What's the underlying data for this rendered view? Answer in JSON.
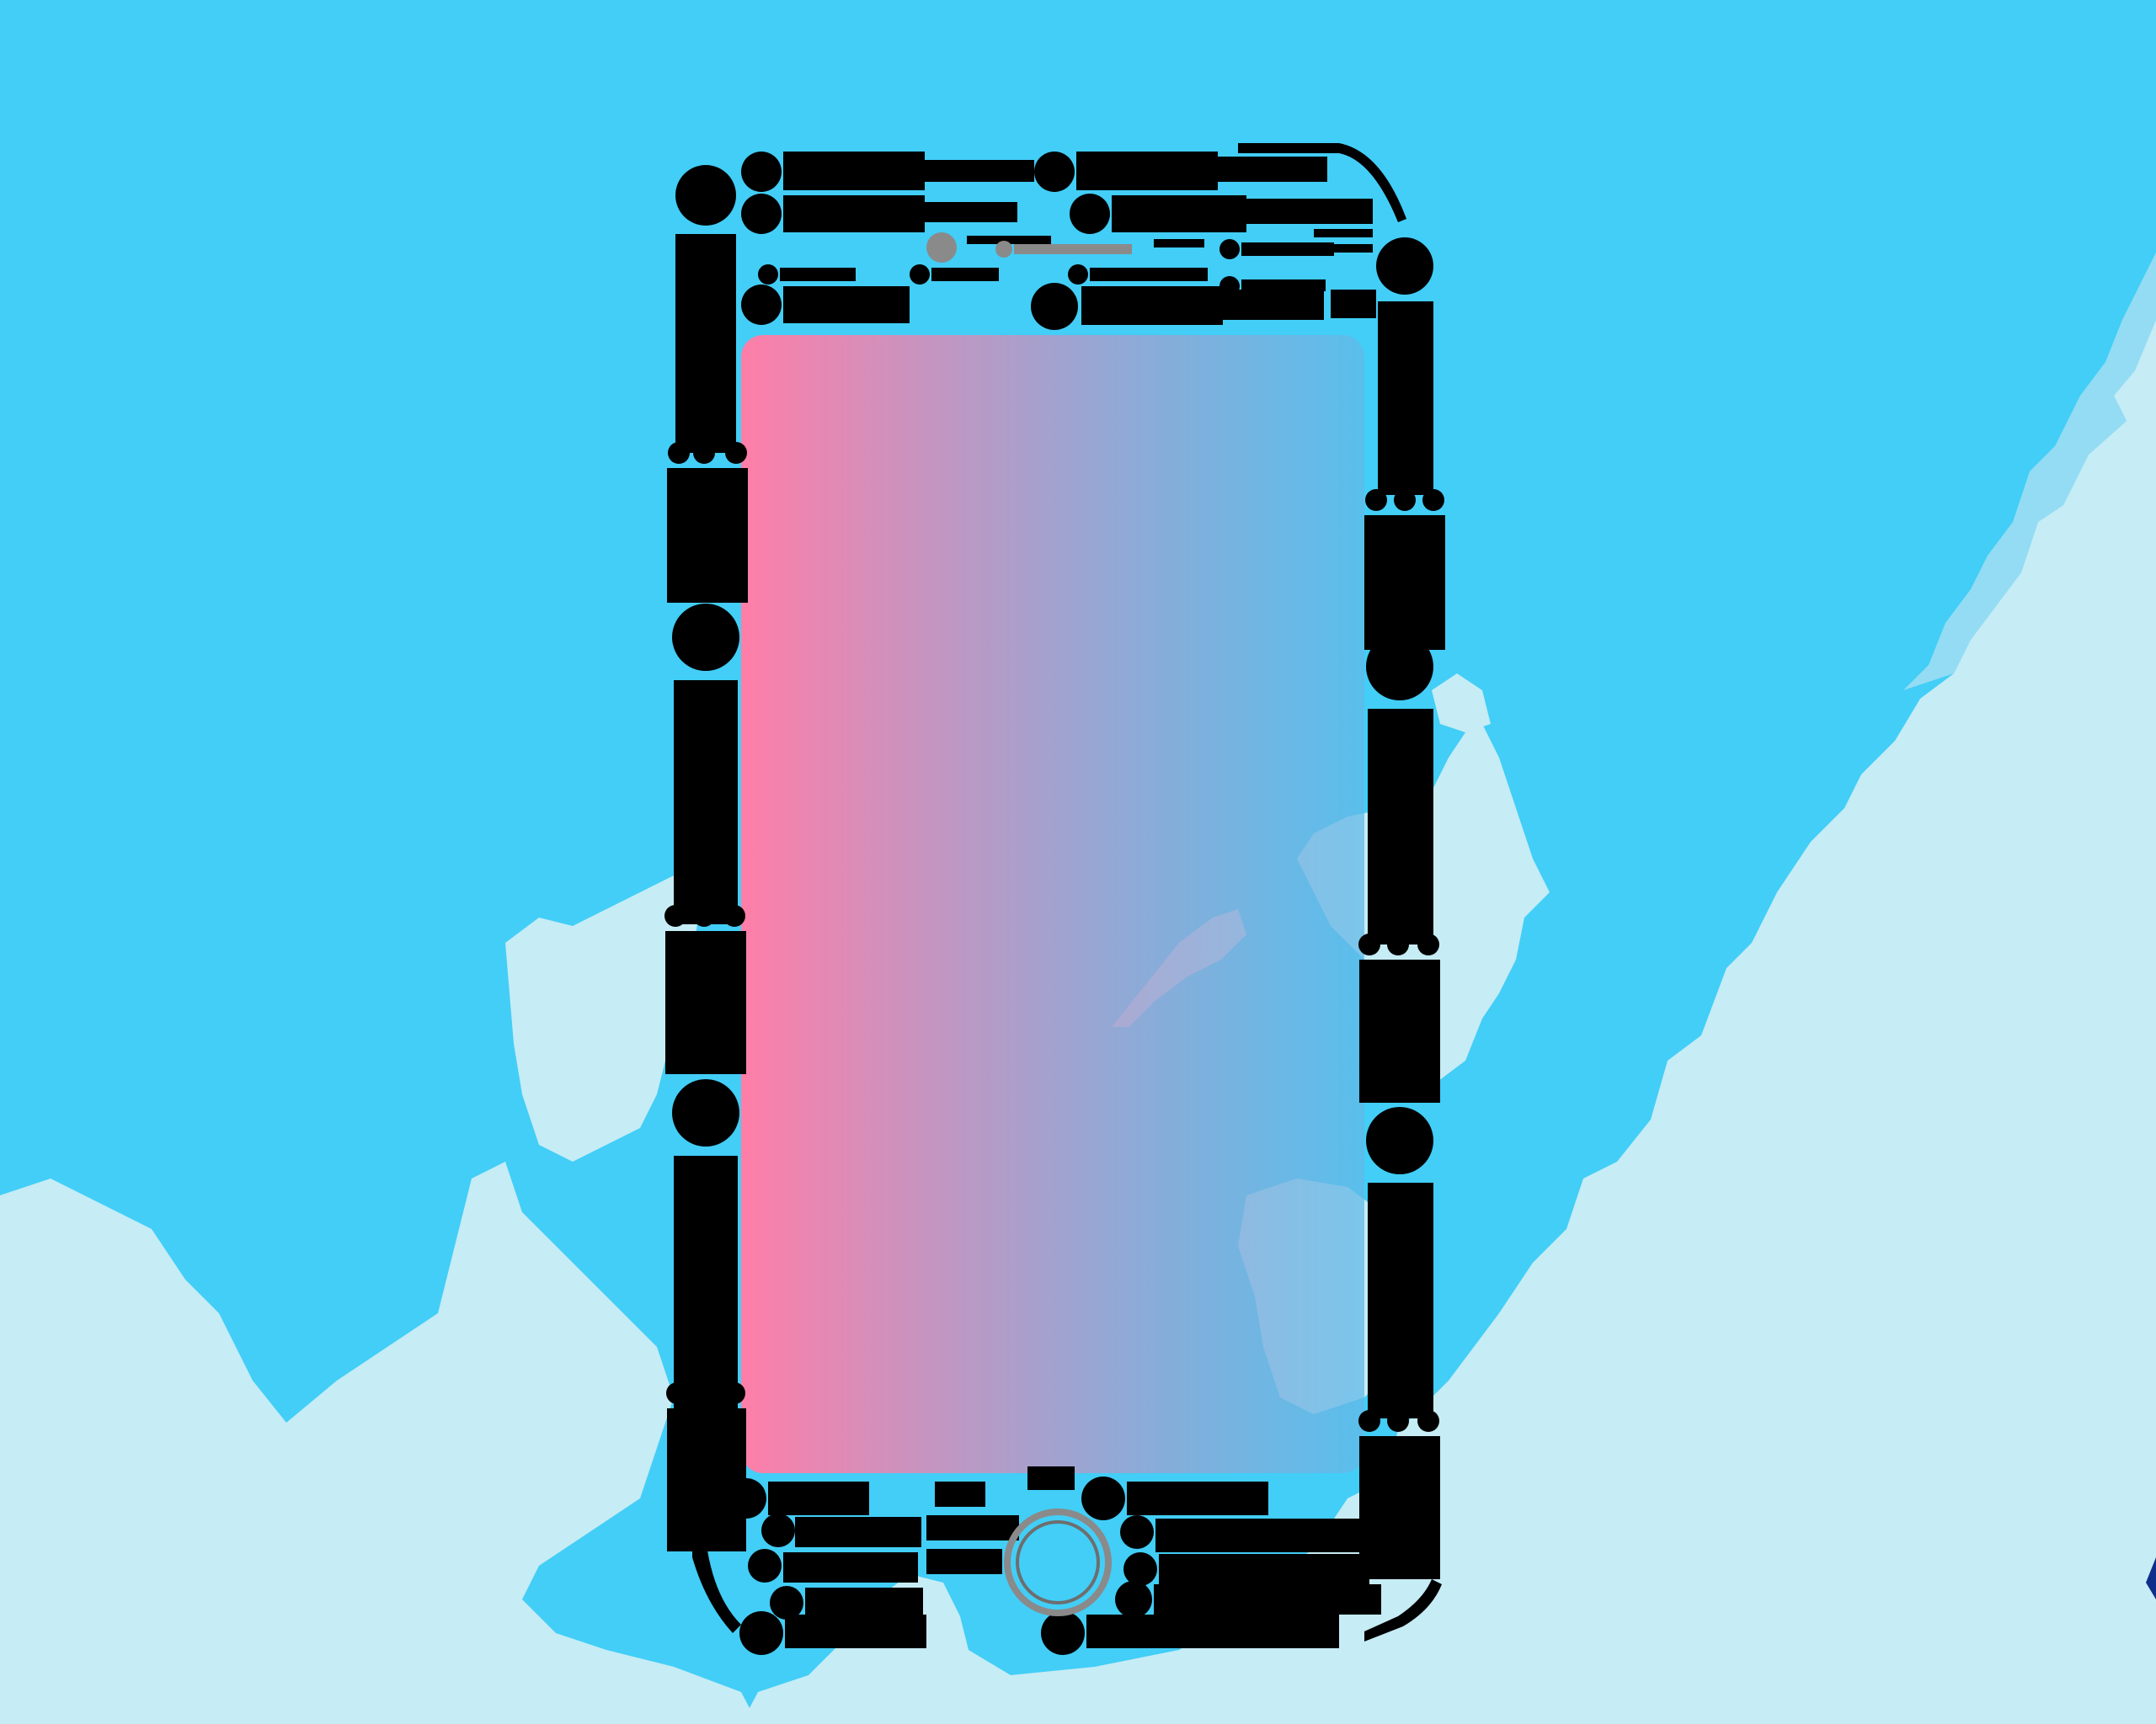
{
  "colors": {
    "ocean": "#42cef7",
    "land": "#c6ecf5",
    "land_shadow": "#a9e0f1",
    "figure": "#000000",
    "accent_grey": "#8a8a8a",
    "screen_gradient_start": "#ff7ea8",
    "screen_gradient_end": "#62b9e8",
    "edge_mark": "#0d2f8a"
  },
  "icons": {
    "people": "person-silhouette-icon",
    "home_button": "home-button-ring-icon",
    "speaker": "speaker-grille-icon",
    "camera": "front-camera-icon",
    "edge_mark": "partial-mark-icon"
  }
}
